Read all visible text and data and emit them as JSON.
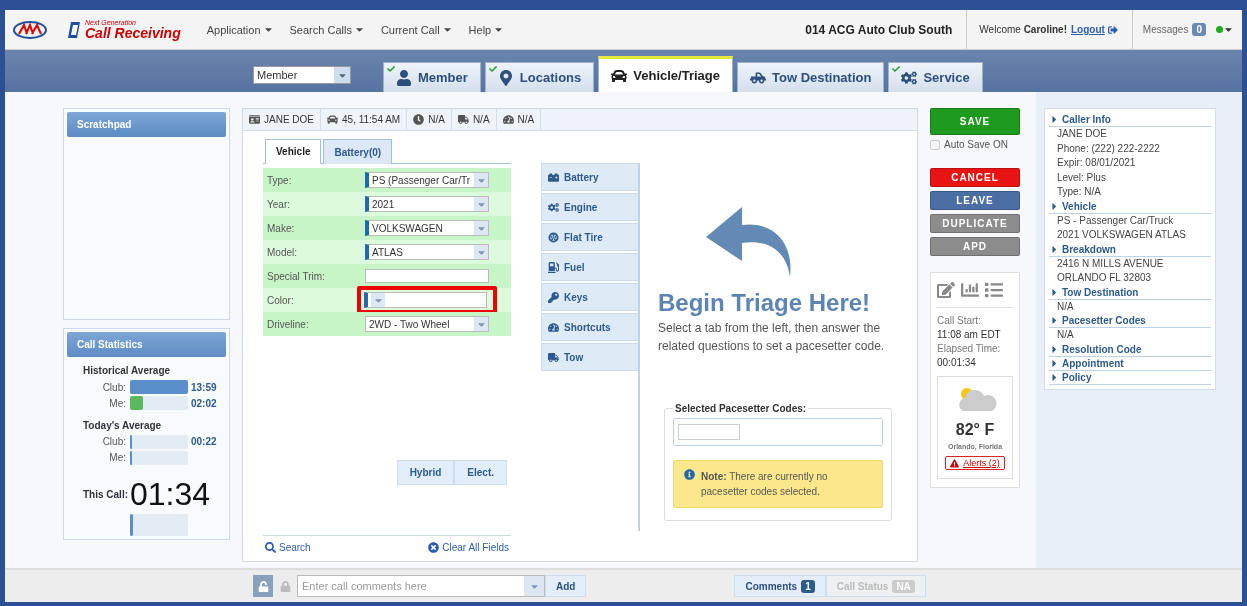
{
  "topbar": {
    "brand_small": "Next Generation",
    "brand": "Call Receiving",
    "menus": [
      "Application",
      "Search Calls",
      "Current Call",
      "Help"
    ],
    "club": "014 ACG Auto Club South",
    "welcome": "Welcome **Caroline!**",
    "logout": "Logout",
    "messages": "Messages",
    "message_count": "0"
  },
  "tabbar": {
    "dropdown": "Member",
    "tabs": [
      {
        "label": "Member",
        "selected": false,
        "checked": true
      },
      {
        "label": "Locations",
        "selected": false,
        "checked": true
      },
      {
        "label": "Vehicle/Triage",
        "selected": true,
        "checked": false
      },
      {
        "label": "Tow Destination",
        "selected": false,
        "checked": false
      },
      {
        "label": "Service",
        "selected": false,
        "checked": true
      }
    ]
  },
  "scratchpad": {
    "title": "Scratchpad"
  },
  "call_statistics": {
    "title": "Call Statistics",
    "groups": [
      {
        "title": "Historical Average",
        "rows": [
          {
            "label": "Club:",
            "value": "13:59",
            "level": 1,
            "kind": "club"
          },
          {
            "label": "Me:",
            "value": "02:02",
            "level": 0.22,
            "kind": "me"
          }
        ]
      },
      {
        "title": "Today's Average",
        "rows": [
          {
            "label": "Club:",
            "value": "00:22",
            "level": 0.04,
            "kind": "club"
          },
          {
            "label": "Me:",
            "level": 0.03,
            "kind": "club"
          }
        ]
      }
    ],
    "this_call": {
      "label": "This Call:",
      "value": "01:34",
      "level": 0.06
    }
  },
  "info_strip": [
    "JANE DOE",
    "45, 11:54 AM",
    "N/A",
    "N/A",
    "N/A"
  ],
  "vehicle_form": {
    "tabs": [
      {
        "label": "Vehicle",
        "selected": true
      },
      {
        "label": "Battery(0)",
        "selected": false
      }
    ],
    "fields": [
      {
        "label": "Type:",
        "value": "PS (Passenger Car/Tr",
        "kind": "select",
        "required": true,
        "highlighted": false
      },
      {
        "label": "Year:",
        "value": "2021",
        "kind": "select",
        "required": true,
        "highlighted": false
      },
      {
        "label": "Make:",
        "value": "VOLKSWAGEN",
        "kind": "select",
        "required": true,
        "highlighted": false
      },
      {
        "label": "Model:",
        "value": "ATLAS",
        "kind": "select",
        "required": true,
        "highlighted": false
      },
      {
        "label": "Special Trim:",
        "kind": "text",
        "required": false,
        "highlighted": false
      },
      {
        "label": "Color:",
        "kind": "select",
        "required": true,
        "highlighted": true
      },
      {
        "label": "Driveline:",
        "value": "2WD - Two Wheel",
        "kind": "select",
        "required": false,
        "highlighted": false
      }
    ],
    "toggles": [
      "Hybrid",
      "Elect."
    ],
    "search": "Search",
    "clear": "Clear All Fields"
  },
  "triage": {
    "categories": [
      {
        "label": "Battery",
        "kind": "battery"
      },
      {
        "label": "Engine",
        "kind": "engine"
      },
      {
        "label": "Flat Tire",
        "kind": "tire"
      },
      {
        "label": "Fuel",
        "kind": "fuel"
      },
      {
        "label": "Keys",
        "kind": "keys"
      },
      {
        "label": "Shortcuts",
        "kind": "shortcuts"
      },
      {
        "label": "Tow",
        "kind": "tow"
      }
    ],
    "heading": "Begin Triage Here!",
    "description": "Select a tab from the left, then answer the related questions to set a pacesetter code.",
    "codes_legend": "Selected Pacesetter Codes:",
    "note": "**Note:** There are currently no pacesetter codes selected."
  },
  "actions": {
    "buttons": [
      {
        "label": "SAVE",
        "kind": "save"
      }
    ],
    "auto_save": {
      "label": "Auto Save ON",
      "checked": false
    },
    "more_buttons": [
      {
        "label": "CANCEL",
        "kind": "cancel"
      },
      {
        "label": "LEAVE",
        "kind": "leave"
      },
      {
        "label": "DUPLICATE",
        "kind": "grey"
      },
      {
        "label": "APD",
        "kind": "grey"
      }
    ]
  },
  "call_info": {
    "start_label": "Call Start:",
    "start": "11:08 am EDT",
    "elapsed_label": "Elapsed Time:",
    "elapsed": "00:01:34",
    "temperature": "82° F",
    "city": "Orlando, Florida",
    "alerts": "Alerts (2)"
  },
  "summary": [
    {
      "title": "Caller Info",
      "lines": [
        "JANE DOE",
        "Phone: (222) 222-2222",
        "Expir: 08/01/2021",
        "Level: Plus",
        "Type: N/A"
      ]
    },
    {
      "title": "Vehicle",
      "lines": [
        "PS - Passenger Car/Truck",
        "2021 VOLKSWAGEN ATLAS"
      ]
    },
    {
      "title": "Breakdown",
      "lines": [
        "2416 N MILLS AVENUE",
        "ORLANDO FL 32803"
      ]
    },
    {
      "title": "Tow Destination",
      "lines": [
        "N/A"
      ]
    },
    {
      "title": "Pacesetter Codes",
      "lines": [
        "N/A"
      ]
    },
    {
      "title": "Resolution Code"
    },
    {
      "title": "Appointment"
    },
    {
      "title": "Policy"
    }
  ],
  "bottom_bar": {
    "comment_placeholder": "Enter call comments here",
    "add": "Add",
    "comments": "Comments",
    "comments_count": "1",
    "call_status": "Call Status",
    "call_status_badge": "NA",
    "call_status_disabled": true
  }
}
